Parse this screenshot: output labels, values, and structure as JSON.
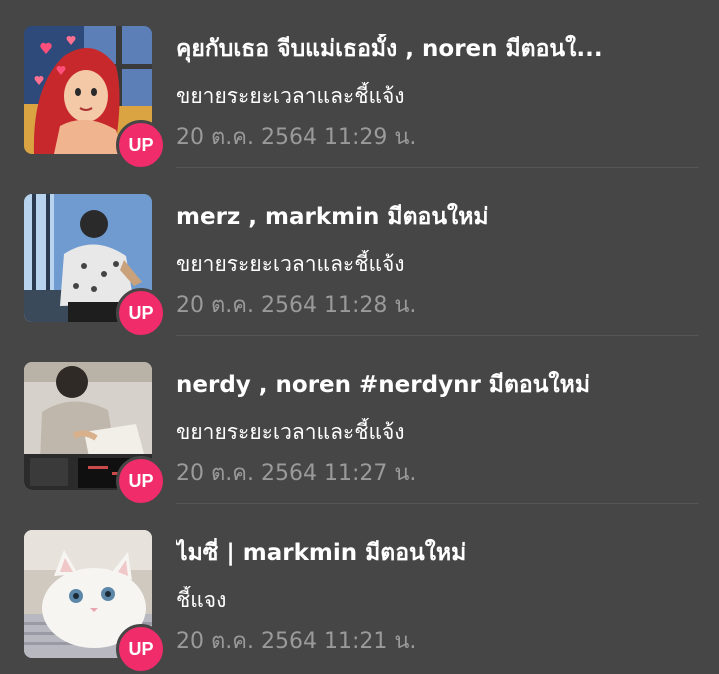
{
  "notifications": [
    {
      "title": "คุยกับเธอ จีบแม่เธอมั้ง , noren มีตอนใ...",
      "subtitle": "ขยายระยะเวลาและชี้แจ้ง",
      "time": "20 ต.ค. 2564 11:29 น.",
      "badge": "UP"
    },
    {
      "title": "merz , markmin มีตอนใหม่",
      "subtitle": "ขยายระยะเวลาและชี้แจ้ง",
      "time": "20 ต.ค. 2564 11:28 น.",
      "badge": "UP"
    },
    {
      "title": "nerdy , noren #nerdynr มีตอนใหม่",
      "subtitle": "ขยายระยะเวลาและชี้แจ้ง",
      "time": "20 ต.ค. 2564 11:27 น.",
      "badge": "UP"
    },
    {
      "title": "ไมซี่ | markmin มีตอนใหม่",
      "subtitle": "ชี้แจง",
      "time": "20 ต.ค. 2564 11:21 น.",
      "badge": "UP"
    }
  ],
  "colors": {
    "background": "#464646",
    "badge": "#f12c6b",
    "time_text": "#9a9a9a"
  }
}
